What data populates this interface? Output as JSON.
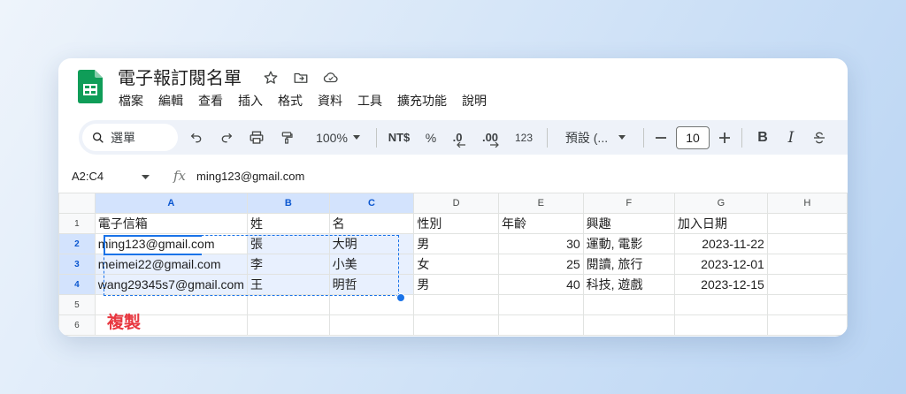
{
  "doc": {
    "title": "電子報訂閱名單"
  },
  "menu": [
    "檔案",
    "編輯",
    "查看",
    "插入",
    "格式",
    "資料",
    "工具",
    "擴充功能",
    "說明"
  ],
  "toolbar": {
    "search_label": "選單",
    "zoom": "100%",
    "currency": "NT$",
    "percent": "%",
    "dec_decrease": ".0",
    "dec_increase": ".00",
    "number_format": "123",
    "font": "預設 (...",
    "font_size": "10",
    "bold": "B",
    "italic": "I"
  },
  "formula_bar": {
    "name_box": "A2:C4",
    "value": "ming123@gmail.com"
  },
  "columns": [
    "A",
    "B",
    "C",
    "D",
    "E",
    "F",
    "G",
    "H"
  ],
  "rows": [
    [
      "電子信箱",
      "姓",
      "名",
      "性別",
      "年齡",
      "興趣",
      "加入日期",
      ""
    ],
    [
      "ming123@gmail.com",
      "張",
      "大明",
      "男",
      "30",
      "運動, 電影",
      "2023-11-22",
      ""
    ],
    [
      "meimei22@gmail.com",
      "李",
      "小美",
      "女",
      "25",
      "閱讀, 旅行",
      "2023-12-01",
      ""
    ],
    [
      "wang29345s7@gmail.com",
      "王",
      "明哲",
      "男",
      "40",
      "科技, 遊戲",
      "2023-12-15",
      ""
    ],
    [
      "",
      "",
      "",
      "",
      "",
      "",
      "",
      ""
    ],
    [
      "",
      "",
      "",
      "",
      "",
      "",
      "",
      ""
    ]
  ],
  "row_numbers": [
    "1",
    "2",
    "3",
    "4",
    "5",
    "6"
  ],
  "annotation": "複製",
  "colors": {
    "accent": "#1a73e8",
    "sheets_green": "#0f9d58",
    "annotation_red": "#e8363f"
  }
}
